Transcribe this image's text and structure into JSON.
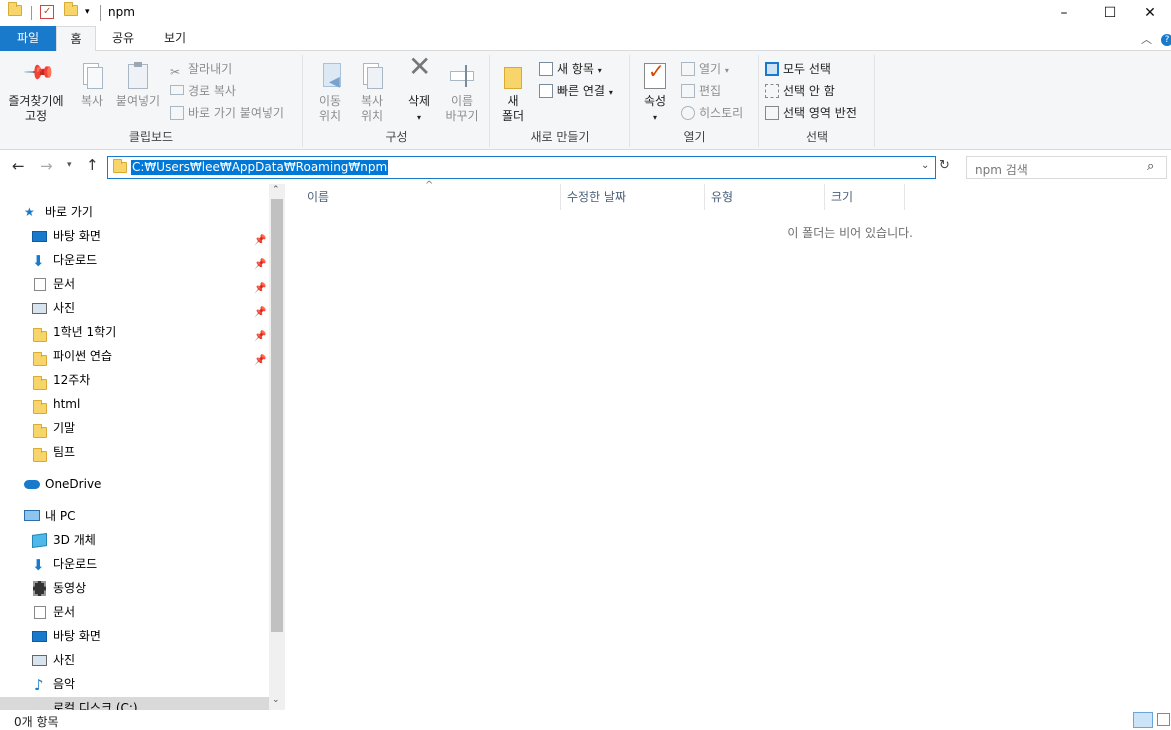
{
  "window": {
    "title": "npm",
    "minimize": "–",
    "maximize": "☐",
    "close": "✕"
  },
  "tabs": [
    {
      "label": "파일"
    },
    {
      "label": "홈"
    },
    {
      "label": "공유"
    },
    {
      "label": "보기"
    }
  ],
  "ribbon": {
    "clipboard": {
      "label": "클립보드",
      "pin_quick": "즐겨찾기에\n고정",
      "copy": "복사",
      "paste": "붙여넣기",
      "cut": "잘라내기",
      "copy_path": "경로 복사",
      "paste_shortcut": "바로 가기 붙여넣기"
    },
    "organize": {
      "label": "구성",
      "move_to": "이동\n위치",
      "copy_to": "복사\n위치",
      "delete": "삭제",
      "rename": "이름\n바꾸기"
    },
    "new": {
      "label": "새로 만들기",
      "new_folder": "새\n폴더",
      "new_item": "새 항목",
      "easy_access": "빠른 연결"
    },
    "open": {
      "label": "열기",
      "properties": "속성",
      "open": "열기",
      "edit": "편집",
      "history": "히스토리"
    },
    "select": {
      "label": "선택",
      "select_all": "모두 선택",
      "select_none": "선택 안 함",
      "invert": "선택 영역 반전"
    }
  },
  "address": {
    "path": "C:₩Users₩lee₩AppData₩Roaming₩npm",
    "search_placeholder": "npm 검색"
  },
  "nav": {
    "quick_access": "바로 가기",
    "quick_items": [
      {
        "label": "바탕 화면"
      },
      {
        "label": "다운로드"
      },
      {
        "label": "문서"
      },
      {
        "label": "사진"
      },
      {
        "label": "1학년 1학기"
      },
      {
        "label": "파이썬 연습"
      },
      {
        "label": "12주차"
      },
      {
        "label": "html"
      },
      {
        "label": "기말"
      },
      {
        "label": "팀프"
      }
    ],
    "onedrive": "OneDrive",
    "this_pc": "내 PC",
    "pc_items": [
      {
        "label": "3D 개체"
      },
      {
        "label": "다운로드"
      },
      {
        "label": "동영상"
      },
      {
        "label": "문서"
      },
      {
        "label": "바탕 화면"
      },
      {
        "label": "사진"
      },
      {
        "label": "음악"
      },
      {
        "label": "로컬 디스크 (C:)"
      }
    ]
  },
  "columns": [
    {
      "label": "이름"
    },
    {
      "label": "수정한 날짜"
    },
    {
      "label": "유형"
    },
    {
      "label": "크기"
    }
  ],
  "empty_message": "이 폴더는 비어 있습니다.",
  "status": {
    "item_count": "0개 항목"
  }
}
